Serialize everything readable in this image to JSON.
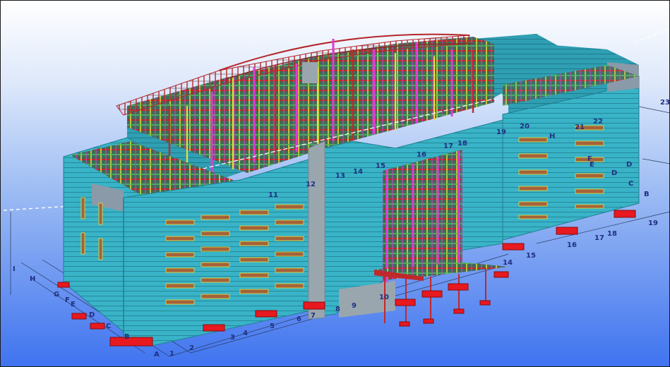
{
  "viewport": {
    "background_top": "#ffffff",
    "background_bottom": "#3f73f0",
    "facade_color": "#39b3c7",
    "steel_red": "#c0282b",
    "steel_magenta": "#e13bd6",
    "steel_yellow": "#e8e03a",
    "steel_green": "#48c25b",
    "footing_color": "#e8191f"
  },
  "gridlines": {
    "numbers": [
      "1",
      "2",
      "3",
      "4",
      "5",
      "6",
      "7",
      "8",
      "9",
      "10",
      "11",
      "12",
      "13",
      "14",
      "15",
      "16",
      "17",
      "18",
      "19",
      "20",
      "21",
      "22",
      "23"
    ],
    "letters": [
      "A",
      "B",
      "C",
      "D",
      "E",
      "F",
      "G",
      "H",
      "I"
    ]
  }
}
